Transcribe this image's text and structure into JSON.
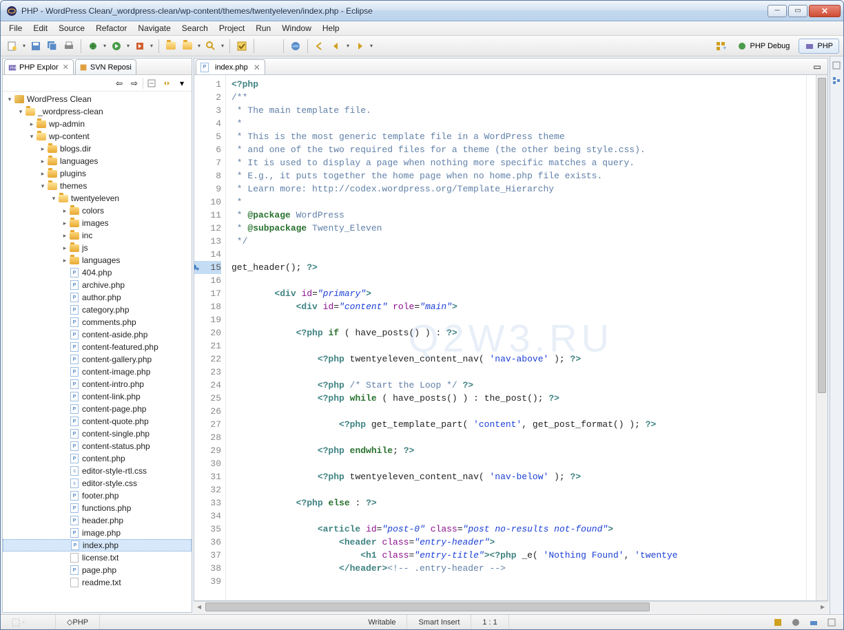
{
  "window": {
    "title": "PHP - WordPress Clean/_wordpress-clean/wp-content/themes/twentyeleven/index.php - Eclipse"
  },
  "menu": [
    "File",
    "Edit",
    "Source",
    "Refactor",
    "Navigate",
    "Search",
    "Project",
    "Run",
    "Window",
    "Help"
  ],
  "perspectives": {
    "debug": "PHP Debug",
    "php": "PHP"
  },
  "sidebar": {
    "tabs": {
      "explorer": "PHP Explor",
      "svn": "SVN Reposi"
    },
    "tree": [
      {
        "d": 0,
        "t": "proj",
        "l": "WordPress Clean",
        "exp": true
      },
      {
        "d": 1,
        "t": "folder",
        "l": "_wordpress-clean",
        "exp": true
      },
      {
        "d": 2,
        "t": "folder",
        "l": "wp-admin",
        "exp": false
      },
      {
        "d": 2,
        "t": "folder",
        "l": "wp-content",
        "exp": true
      },
      {
        "d": 3,
        "t": "folder",
        "l": "blogs.dir",
        "exp": false
      },
      {
        "d": 3,
        "t": "folder",
        "l": "languages",
        "exp": false
      },
      {
        "d": 3,
        "t": "folder",
        "l": "plugins",
        "exp": false
      },
      {
        "d": 3,
        "t": "folder",
        "l": "themes",
        "exp": true
      },
      {
        "d": 4,
        "t": "folder",
        "l": "twentyeleven",
        "exp": true
      },
      {
        "d": 5,
        "t": "folder",
        "l": "colors",
        "exp": false
      },
      {
        "d": 5,
        "t": "folder",
        "l": "images",
        "exp": false
      },
      {
        "d": 5,
        "t": "folder",
        "l": "inc",
        "exp": false
      },
      {
        "d": 5,
        "t": "folder",
        "l": "js",
        "exp": false
      },
      {
        "d": 5,
        "t": "folder",
        "l": "languages",
        "exp": false
      },
      {
        "d": 5,
        "t": "php",
        "l": "404.php"
      },
      {
        "d": 5,
        "t": "php",
        "l": "archive.php"
      },
      {
        "d": 5,
        "t": "php",
        "l": "author.php"
      },
      {
        "d": 5,
        "t": "php",
        "l": "category.php"
      },
      {
        "d": 5,
        "t": "php",
        "l": "comments.php"
      },
      {
        "d": 5,
        "t": "php",
        "l": "content-aside.php"
      },
      {
        "d": 5,
        "t": "php",
        "l": "content-featured.php"
      },
      {
        "d": 5,
        "t": "php",
        "l": "content-gallery.php"
      },
      {
        "d": 5,
        "t": "php",
        "l": "content-image.php"
      },
      {
        "d": 5,
        "t": "php",
        "l": "content-intro.php"
      },
      {
        "d": 5,
        "t": "php",
        "l": "content-link.php"
      },
      {
        "d": 5,
        "t": "php",
        "l": "content-page.php"
      },
      {
        "d": 5,
        "t": "php",
        "l": "content-quote.php"
      },
      {
        "d": 5,
        "t": "php",
        "l": "content-single.php"
      },
      {
        "d": 5,
        "t": "php",
        "l": "content-status.php"
      },
      {
        "d": 5,
        "t": "php",
        "l": "content.php"
      },
      {
        "d": 5,
        "t": "css",
        "l": "editor-style-rtl.css"
      },
      {
        "d": 5,
        "t": "css",
        "l": "editor-style.css"
      },
      {
        "d": 5,
        "t": "php",
        "l": "footer.php"
      },
      {
        "d": 5,
        "t": "php",
        "l": "functions.php"
      },
      {
        "d": 5,
        "t": "php",
        "l": "header.php"
      },
      {
        "d": 5,
        "t": "php",
        "l": "image.php"
      },
      {
        "d": 5,
        "t": "php",
        "l": "index.php",
        "sel": true
      },
      {
        "d": 5,
        "t": "txt",
        "l": "license.txt"
      },
      {
        "d": 5,
        "t": "php",
        "l": "page.php"
      },
      {
        "d": 5,
        "t": "txt",
        "l": "readme.txt"
      }
    ]
  },
  "editor": {
    "tab": "index.php",
    "current_line": 15,
    "lines": [
      {
        "n": 1,
        "h": "<span class='k-tag'>&lt;?php</span>"
      },
      {
        "n": 2,
        "h": "<span class='k-comm'>/**</span>"
      },
      {
        "n": 3,
        "h": "<span class='k-comm'> * The main template file.</span>"
      },
      {
        "n": 4,
        "h": "<span class='k-comm'> *</span>"
      },
      {
        "n": 5,
        "h": "<span class='k-comm'> * This is the most generic template file in a WordPress theme</span>"
      },
      {
        "n": 6,
        "h": "<span class='k-comm'> * and one of the two required files for a theme (the other being style.css).</span>"
      },
      {
        "n": 7,
        "h": "<span class='k-comm'> * It is used to display a page when nothing more specific matches a query.</span>"
      },
      {
        "n": 8,
        "h": "<span class='k-comm'> * E.g., it puts together the home page when no home.php file exists.</span>"
      },
      {
        "n": 9,
        "h": "<span class='k-comm'> * Learn more: http://codex.wordpress.org/Template_Hierarchy</span>"
      },
      {
        "n": 10,
        "h": "<span class='k-comm'> *</span>"
      },
      {
        "n": 11,
        "h": "<span class='k-comm'> * <span class='k-key'>@package</span> WordPress</span>"
      },
      {
        "n": 12,
        "h": "<span class='k-comm'> * <span class='k-key'>@subpackage</span> Twenty_Eleven</span>"
      },
      {
        "n": 13,
        "h": "<span class='k-comm'> */</span>"
      },
      {
        "n": 14,
        "h": ""
      },
      {
        "n": 15,
        "h": "get_header(); <span class='k-tag'>?&gt;</span>",
        "mark": true
      },
      {
        "n": 16,
        "h": ""
      },
      {
        "n": 17,
        "h": "        <span class='k-tag'>&lt;div</span> <span class='k-attr'>id</span>=<span class='k-str'>\"primary\"</span><span class='k-tag'>&gt;</span>"
      },
      {
        "n": 18,
        "h": "            <span class='k-tag'>&lt;div</span> <span class='k-attr'>id</span>=<span class='k-str'>\"content\"</span> <span class='k-attr'>role</span>=<span class='k-str'>\"main\"</span><span class='k-tag'>&gt;</span>"
      },
      {
        "n": 19,
        "h": ""
      },
      {
        "n": 20,
        "h": "            <span class='k-tag'>&lt;?php</span> <span class='k-key'>if</span> ( have_posts() ) : <span class='k-tag'>?&gt;</span>"
      },
      {
        "n": 21,
        "h": ""
      },
      {
        "n": 22,
        "h": "                <span class='k-tag'>&lt;?php</span> twentyeleven_content_nav( <span class='k-str2'>'nav-above'</span> ); <span class='k-tag'>?&gt;</span>"
      },
      {
        "n": 23,
        "h": ""
      },
      {
        "n": 24,
        "h": "                <span class='k-tag'>&lt;?php</span> <span class='k-comm'>/* Start the Loop */</span> <span class='k-tag'>?&gt;</span>"
      },
      {
        "n": 25,
        "h": "                <span class='k-tag'>&lt;?php</span> <span class='k-key'>while</span> ( have_posts() ) : the_post(); <span class='k-tag'>?&gt;</span>"
      },
      {
        "n": 26,
        "h": ""
      },
      {
        "n": 27,
        "h": "                    <span class='k-tag'>&lt;?php</span> get_template_part( <span class='k-str2'>'content'</span>, get_post_format() ); <span class='k-tag'>?&gt;</span>"
      },
      {
        "n": 28,
        "h": ""
      },
      {
        "n": 29,
        "h": "                <span class='k-tag'>&lt;?php</span> <span class='k-key'>endwhile</span>; <span class='k-tag'>?&gt;</span>"
      },
      {
        "n": 30,
        "h": ""
      },
      {
        "n": 31,
        "h": "                <span class='k-tag'>&lt;?php</span> twentyeleven_content_nav( <span class='k-str2'>'nav-below'</span> ); <span class='k-tag'>?&gt;</span>"
      },
      {
        "n": 32,
        "h": ""
      },
      {
        "n": 33,
        "h": "            <span class='k-tag'>&lt;?php</span> <span class='k-key'>else</span> : <span class='k-tag'>?&gt;</span>"
      },
      {
        "n": 34,
        "h": ""
      },
      {
        "n": 35,
        "h": "                <span class='k-tag'>&lt;article</span> <span class='k-attr'>id</span>=<span class='k-str'>\"post-0\"</span> <span class='k-attr'>class</span>=<span class='k-str'>\"post no-results not-found\"</span><span class='k-tag'>&gt;</span>"
      },
      {
        "n": 36,
        "h": "                    <span class='k-tag'>&lt;header</span> <span class='k-attr'>class</span>=<span class='k-str'>\"entry-header\"</span><span class='k-tag'>&gt;</span>"
      },
      {
        "n": 37,
        "h": "                        <span class='k-tag'>&lt;h1</span> <span class='k-attr'>class</span>=<span class='k-str'>\"entry-title\"</span><span class='k-tag'>&gt;&lt;?php</span> _e( <span class='k-str2'>'Nothing Found'</span>, <span class='k-str2'>'twentye</span>"
      },
      {
        "n": 38,
        "h": "                    <span class='k-tag'>&lt;/header&gt;</span><span class='k-comm'>&lt;!-- .entry-header --&gt;</span>"
      },
      {
        "n": 39,
        "h": ""
      }
    ]
  },
  "status": {
    "writable": "Writable",
    "insert": "Smart Insert",
    "pos": "1 : 1",
    "breadcrumb": "PHP"
  },
  "watermark": "Q2W3.RU"
}
